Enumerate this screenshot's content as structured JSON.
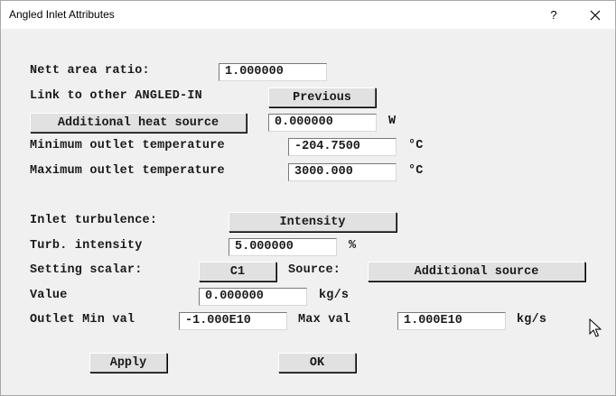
{
  "window": {
    "title": "Angled Inlet Attributes",
    "help_glyph": "?",
    "close_glyph": "✕"
  },
  "nett_area": {
    "label": "Nett area ratio:",
    "value": "1.000000"
  },
  "link": {
    "label": "Link to other ANGLED-IN",
    "button": "Previous"
  },
  "heat_source": {
    "button": "Additional heat source",
    "value": "0.000000",
    "unit": "W"
  },
  "min_outlet": {
    "label": "Minimum outlet temperature",
    "value": "-204.7500",
    "unit": "°C"
  },
  "max_outlet": {
    "label": "Maximum outlet temperature",
    "value": "3000.000",
    "unit": "°C"
  },
  "turbulence": {
    "label": "Inlet turbulence:",
    "button": "Intensity"
  },
  "turb_intensity": {
    "label": "Turb. intensity",
    "value": "5.000000",
    "unit": "%"
  },
  "scalar": {
    "label": "Setting scalar:",
    "button": "C1",
    "source_label": "Source:",
    "source_button": "Additional source"
  },
  "value_row": {
    "label": "Value",
    "value": "0.000000",
    "unit": "kg/s"
  },
  "outlet_range": {
    "label": "Outlet Min val",
    "min_value": "-1.000E10",
    "max_label": "Max val",
    "max_value": "1.000E10",
    "unit": "kg/s"
  },
  "actions": {
    "apply": "Apply",
    "ok": "OK"
  }
}
